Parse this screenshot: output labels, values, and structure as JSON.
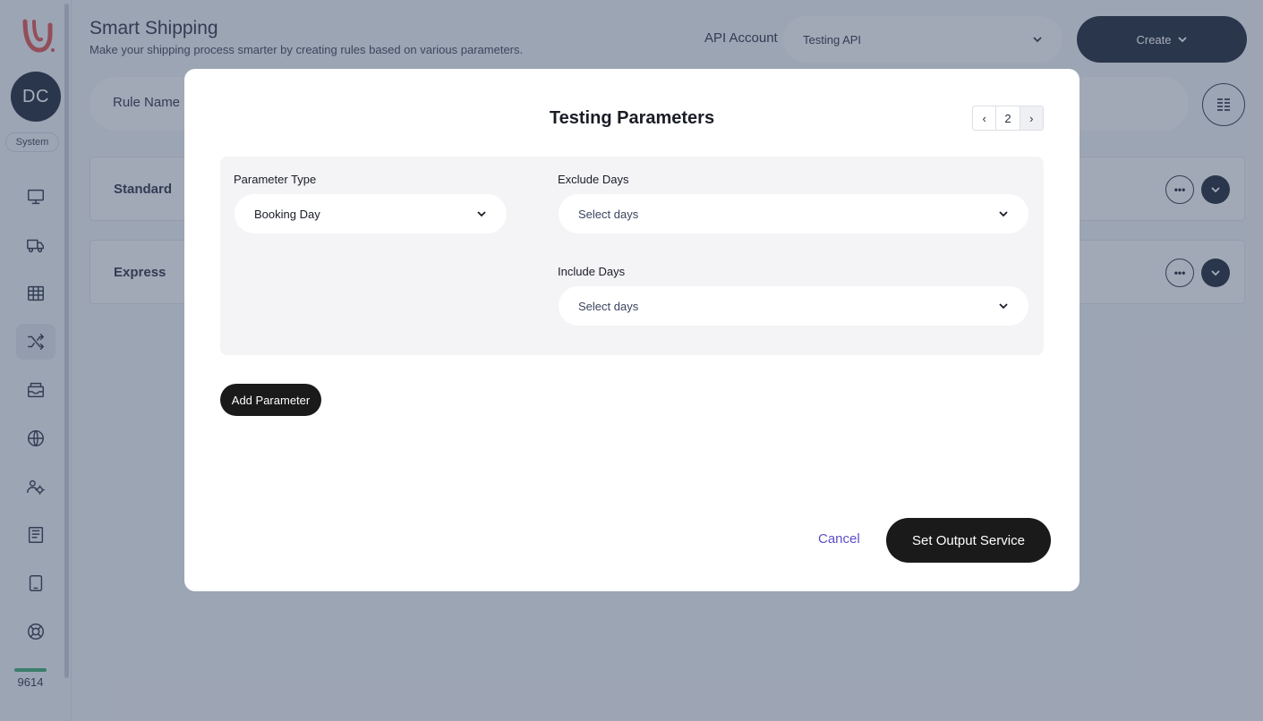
{
  "sidebar": {
    "avatar_initials": "DC",
    "role": "System",
    "credits": "9614",
    "items": [
      {
        "icon": "desktop-icon"
      },
      {
        "icon": "truck-icon"
      },
      {
        "icon": "grid-icon"
      },
      {
        "icon": "shuffle-icon"
      },
      {
        "icon": "inbox-icon"
      },
      {
        "icon": "globe-icon"
      },
      {
        "icon": "users-settings-icon"
      },
      {
        "icon": "book-icon"
      },
      {
        "icon": "tablet-icon"
      },
      {
        "icon": "lifebuoy-icon"
      }
    ]
  },
  "header": {
    "title": "Smart Shipping",
    "subtitle": "Make your shipping process smarter by creating rules based on various parameters.",
    "api_account_label": "API Account",
    "api_account_value": "Testing API",
    "create_label": "Create"
  },
  "filters": {
    "rule_name_label": "Rule Name"
  },
  "rules": [
    {
      "name": "Standard"
    },
    {
      "name": "Express"
    }
  ],
  "modal": {
    "title": "Testing Parameters",
    "pager": {
      "prev": "‹",
      "page": "2",
      "next": "›"
    },
    "parameter_type_label": "Parameter Type",
    "parameter_type_value": "Booking Day",
    "exclude_days_label": "Exclude Days",
    "exclude_days_placeholder": "Select days",
    "include_days_label": "Include Days",
    "include_days_placeholder": "Select days",
    "add_parameter_label": "Add Parameter",
    "cancel_label": "Cancel",
    "set_output_label": "Set Output Service"
  },
  "colors": {
    "primary_dark": "#1d2636",
    "button_black": "#1a1a1a",
    "link_purple": "#5b4fc7",
    "brand_red": "#d9534f",
    "credits_green": "#3aa76d"
  }
}
